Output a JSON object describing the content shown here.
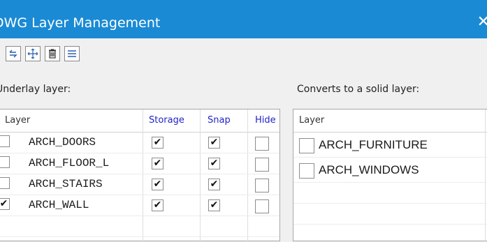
{
  "window": {
    "title": "DWG Layer Management",
    "close_glyph": "✕"
  },
  "toolbar": {
    "buttons": [
      {
        "name": "undo-icon"
      },
      {
        "name": "move-icon"
      },
      {
        "name": "delete-icon"
      },
      {
        "name": "menu-icon"
      }
    ]
  },
  "underlay": {
    "label": "Underlay layer:",
    "columns": {
      "layer": "Layer",
      "storage": "Storage",
      "snap": "Snap",
      "hide": "Hide"
    },
    "rows": [
      {
        "layer": "ARCH_DOORS",
        "layer_checked": false,
        "storage": true,
        "snap": true,
        "hide": false
      },
      {
        "layer": "ARCH_FLOOR_L",
        "layer_checked": false,
        "storage": true,
        "snap": true,
        "hide": false
      },
      {
        "layer": "ARCH_STAIRS",
        "layer_checked": false,
        "storage": true,
        "snap": true,
        "hide": false
      },
      {
        "layer": "ARCH_WALL",
        "layer_checked": true,
        "storage": true,
        "snap": true,
        "hide": false
      }
    ]
  },
  "solid": {
    "label": "Converts to a solid layer:",
    "columns": {
      "layer": "Layer"
    },
    "rows": [
      {
        "layer": "ARCH_FURNITURE",
        "checked": false
      },
      {
        "layer": "ARCH_WINDOWS",
        "checked": false
      }
    ]
  },
  "colors": {
    "titlebar": "#1a8ad4",
    "header_link": "#2222cc"
  }
}
